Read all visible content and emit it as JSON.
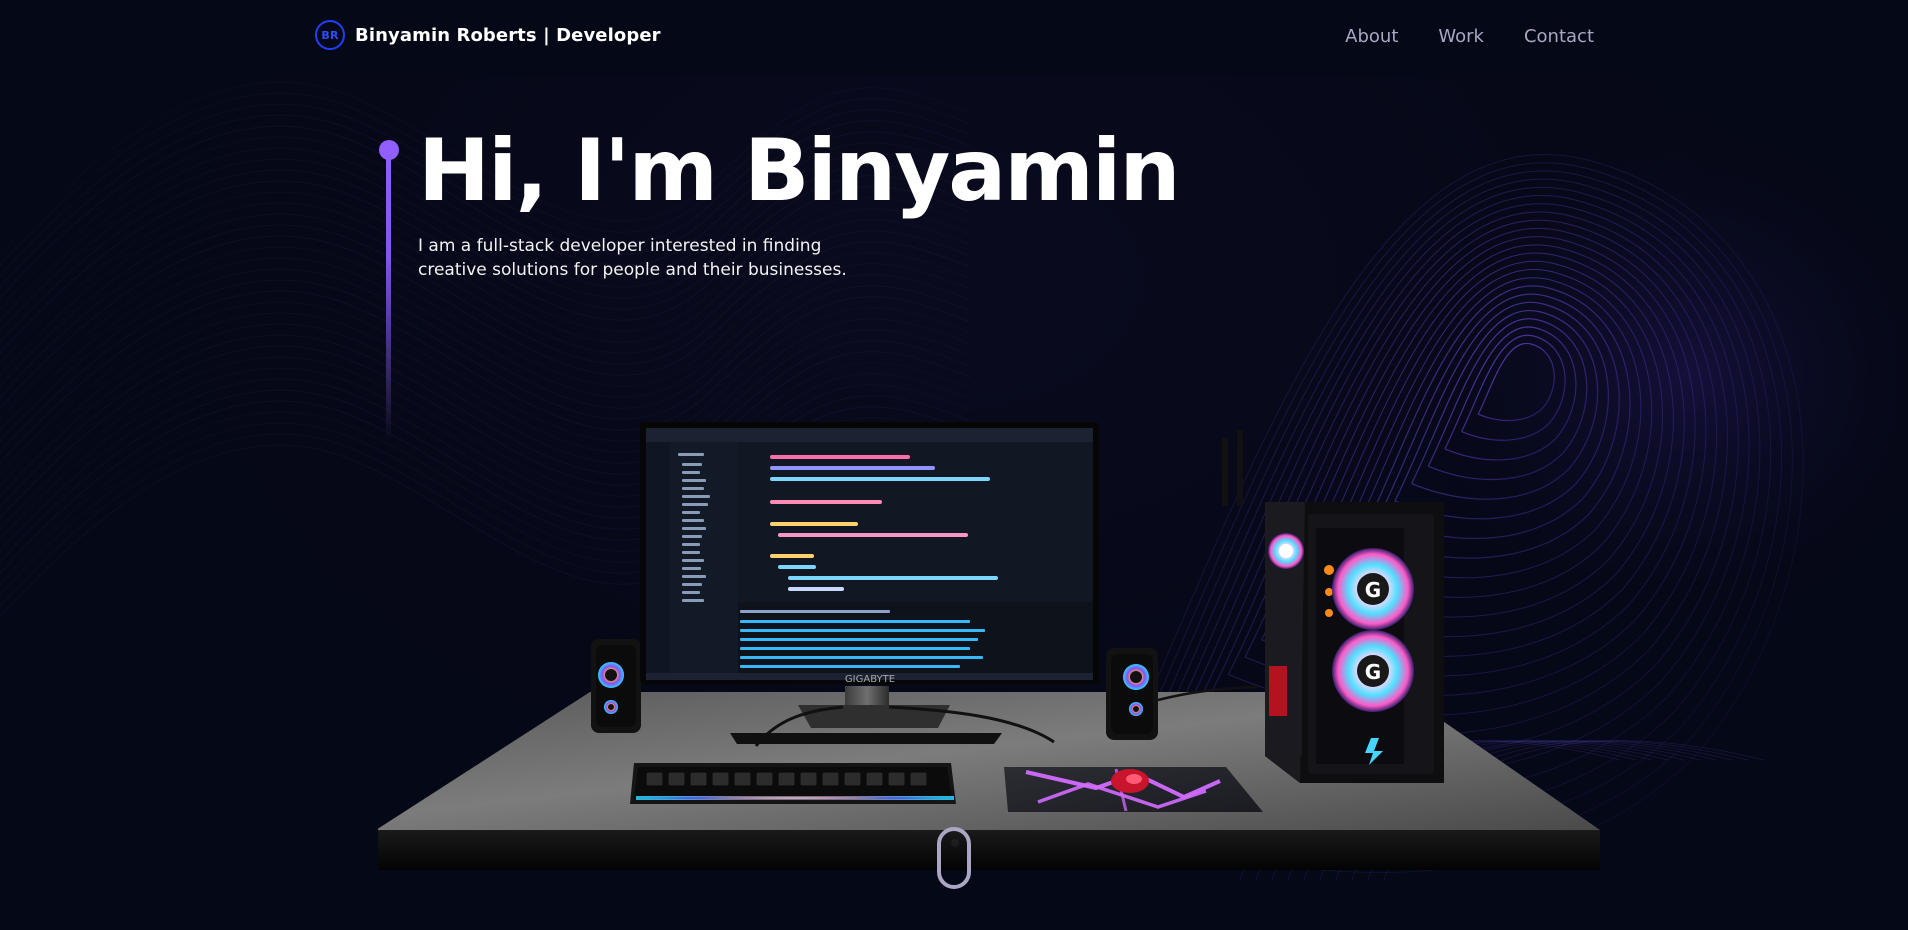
{
  "site": {
    "logo_text": "BR",
    "title": "Binyamin Roberts | Developer"
  },
  "nav": {
    "links": [
      "About",
      "Work",
      "Contact"
    ]
  },
  "hero": {
    "title": "Hi, I'm Binyamin",
    "subtitle": "I am a full-stack developer interested in finding creative solutions for people and their businesses."
  },
  "scene": {
    "monitor_brand": "GIGABYTE"
  },
  "colors": {
    "background": "#050816",
    "accent": "#915eff",
    "brand_blue": "#1f3fff",
    "nav_text": "#aaa6c3"
  },
  "icons": {
    "brand_logo": "br-logo-icon",
    "scroll": "mouse-scroll-icon"
  }
}
